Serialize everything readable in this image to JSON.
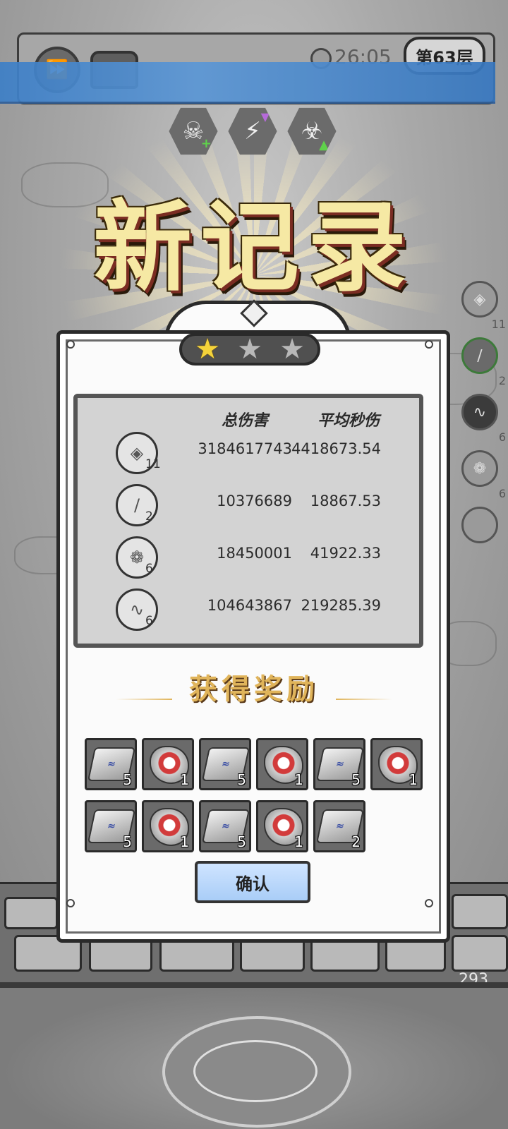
{
  "hud": {
    "timer": "26:05",
    "level": "第63层",
    "fast_forward_icon": "fast-forward-icon",
    "chest_icon": "chest-icon"
  },
  "buffs": [
    {
      "name": "skull-heal-buff-icon"
    },
    {
      "name": "lightning-buff-icon"
    },
    {
      "name": "bone-beast-buff-icon"
    }
  ],
  "title": "新记录",
  "stars": {
    "earned": 1,
    "total": 3
  },
  "side_slots": [
    {
      "count": "11",
      "style": "normal"
    },
    {
      "count": "2",
      "style": "active"
    },
    {
      "count": "6",
      "style": "dark"
    },
    {
      "count": "6",
      "style": "normal"
    },
    {
      "count": "",
      "style": "normal"
    }
  ],
  "stats": {
    "header_total": "总伤害",
    "header_avg": "平均秒伤",
    "rows": [
      {
        "icon": "ice-block-icon",
        "count": "11",
        "total": "3184617743",
        "avg": "4418673.54"
      },
      {
        "icon": "meteor-icon",
        "count": "2",
        "total": "10376689",
        "avg": "18867.53"
      },
      {
        "icon": "crystal-burst-icon",
        "count": "6",
        "total": "18450001",
        "avg": "41922.33"
      },
      {
        "icon": "tornado-icon",
        "count": "6",
        "total": "104643867",
        "avg": "219285.39"
      }
    ]
  },
  "rewards": {
    "title": "获得奖励",
    "items": [
      {
        "type": "ingot",
        "qty": "5"
      },
      {
        "type": "ore",
        "qty": "1"
      },
      {
        "type": "ingot",
        "qty": "5"
      },
      {
        "type": "ore",
        "qty": "1"
      },
      {
        "type": "ingot",
        "qty": "5"
      },
      {
        "type": "ore",
        "qty": "1"
      },
      {
        "type": "ingot",
        "qty": "5"
      },
      {
        "type": "ore",
        "qty": "1"
      },
      {
        "type": "ingot",
        "qty": "5"
      },
      {
        "type": "ore",
        "qty": "1"
      },
      {
        "type": "ingot",
        "qty": "2"
      }
    ]
  },
  "confirm_label": "确认",
  "wall_counter": "293"
}
